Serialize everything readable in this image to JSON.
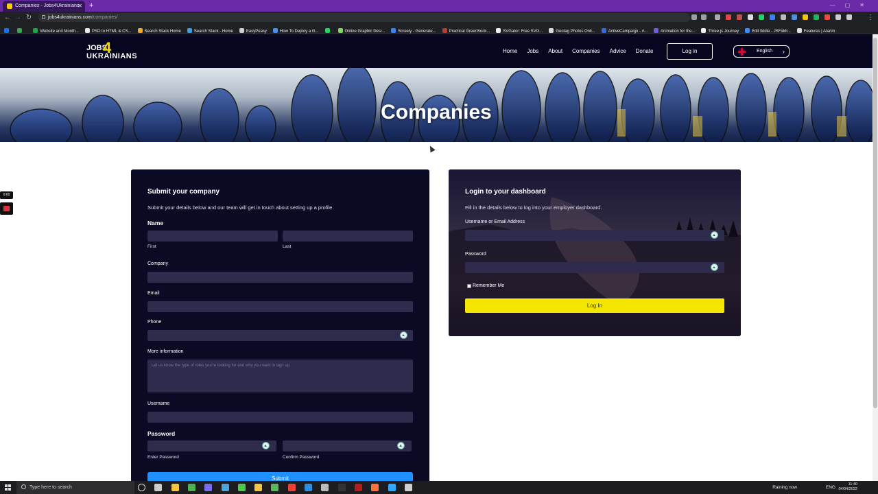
{
  "browser": {
    "tab_title": "Companies - Jobs4Ukrainians",
    "url_host": "jobs4ukrainians.com",
    "url_path": "/companies/",
    "bookmarks": [
      {
        "label": "Website and Month...",
        "color": "#1fa34a"
      },
      {
        "label": "PSD to HTML & CS...",
        "color": "#e8e8e8"
      },
      {
        "label": "Search Stack Home",
        "color": "#f5a623"
      },
      {
        "label": "Search Stack - Home",
        "color": "#37a0e6"
      },
      {
        "label": "EasyPeasy",
        "color": "#cfcfcf"
      },
      {
        "label": "How To Deploy a G...",
        "color": "#4d8fe8"
      },
      {
        "label": "",
        "color": "#25d366"
      },
      {
        "label": "Online Graphic Desi...",
        "color": "#7ed957"
      },
      {
        "label": "Screely - Generate...",
        "color": "#3b82f6"
      },
      {
        "label": "Practical GreenSock...",
        "color": "#c0392b"
      },
      {
        "label": "SVGator: Free SVG...",
        "color": "#eeeeee"
      },
      {
        "label": "Geotag Photos Onli...",
        "color": "#d9d9d9"
      },
      {
        "label": "ActiveCampaign - #...",
        "color": "#356ae6"
      },
      {
        "label": "Animation for the...",
        "color": "#6c5ce7"
      },
      {
        "label": "Three.js Journey",
        "color": "#f0f0f0"
      },
      {
        "label": "Edit fiddle - JSFiddl...",
        "color": "#3d8bfd"
      },
      {
        "label": "Features | Atarim",
        "color": "#dddddd"
      }
    ]
  },
  "site": {
    "logo": {
      "line1": "JOBS",
      "four": "4",
      "line2": "UKRAINIANS"
    },
    "nav": [
      {
        "label": "Home"
      },
      {
        "label": "Jobs"
      },
      {
        "label": "About"
      },
      {
        "label": "Companies"
      },
      {
        "label": "Advice"
      },
      {
        "label": "Donate"
      }
    ],
    "login_label": "Log in",
    "language_label": "English",
    "hero_title": "Companies"
  },
  "submit_form": {
    "title": "Submit your company",
    "description": "Submit your details below and our team will get in touch about setting up a profile.",
    "name_label": "Name",
    "first_label": "First",
    "last_label": "Last",
    "company_label": "Company",
    "email_label": "Email",
    "phone_label": "Phone",
    "more_info_label": "More information",
    "more_info_placeholder": "Let us know the type of roles you're looking for and why you want to sign up.",
    "username_label": "Username",
    "password_label": "Password",
    "enter_password_label": "Enter Password",
    "confirm_password_label": "Confirm Password",
    "submit_label": "Submit"
  },
  "login_form": {
    "title": "Login to your dashboard",
    "description": "Fill in the details below to log into your employer dashboard.",
    "username_label": "Username or Email Address",
    "password_label": "Password",
    "remember_label": "Remember Me",
    "login_button_label": "Log In"
  },
  "recorder": {
    "time": "0:00"
  },
  "taskbar": {
    "search_placeholder": "Type here to search",
    "weather": "Raining now",
    "lang": "ENG",
    "time": "11:40",
    "date": "04/04/2022",
    "apps": [
      {
        "name": "circle-icon",
        "color": "#dddddd"
      },
      {
        "name": "task-view-icon",
        "color": "#cccccc"
      },
      {
        "name": "file-explorer-icon",
        "color": "#f4c542"
      },
      {
        "name": "chrome-icon",
        "color": "#4caf50"
      },
      {
        "name": "app-icon",
        "color": "#7a6cf0"
      },
      {
        "name": "app-icon",
        "color": "#4aa3df"
      },
      {
        "name": "app-icon",
        "color": "#4bc94b"
      },
      {
        "name": "folder-icon",
        "color": "#f4c542"
      },
      {
        "name": "chrome-icon",
        "color": "#5bb75b"
      },
      {
        "name": "chrome-icon",
        "color": "#ea4335"
      },
      {
        "name": "vscode-icon",
        "color": "#2f8ee0"
      },
      {
        "name": "terminal-icon",
        "color": "#bbbbbb"
      },
      {
        "name": "terminal-icon",
        "color": "#333333"
      },
      {
        "name": "filezilla-icon",
        "color": "#b71c1c"
      },
      {
        "name": "firefox-icon",
        "color": "#ff7139"
      },
      {
        "name": "photoshop-icon",
        "color": "#31a8ff"
      },
      {
        "name": "app-icon",
        "color": "#cfcfcf"
      }
    ]
  },
  "colors": {
    "site_nav_bg": "#070620",
    "card_bg": "#0b0a25",
    "field_bg": "#2e2b4d",
    "accent_yellow": "#f5e600",
    "submit_blue": "#1e90ff",
    "browser_tab_bar": "#6b2aa8"
  }
}
